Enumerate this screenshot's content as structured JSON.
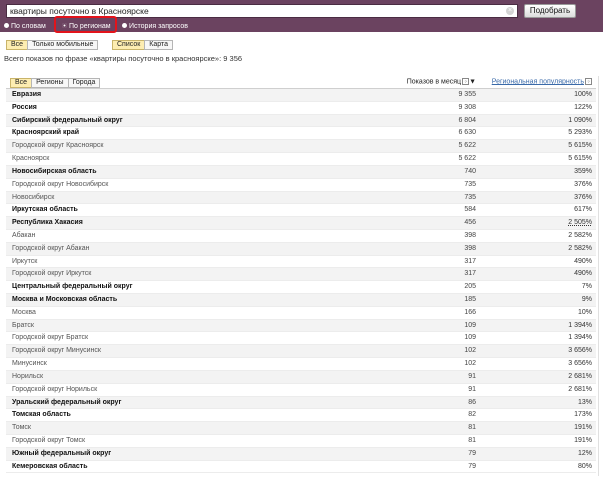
{
  "search": {
    "query": "квартиры посуточно в Красноярске",
    "submit_label": "Подобрать",
    "clear_icon": "×"
  },
  "modes": [
    {
      "label": "По словам",
      "active": false
    },
    {
      "label": "По регионам",
      "active": true
    },
    {
      "label": "История запросов",
      "active": false
    }
  ],
  "filter": {
    "all": "Все",
    "mobile": "Только мобильные"
  },
  "view": {
    "list": "Список",
    "map": "Карта"
  },
  "summary": "Всего показов по фразе «квартиры посуточно в красноярске»: 9 356",
  "table": {
    "tabs": [
      "Все",
      "Регионы",
      "Города"
    ],
    "col_count": "Показов в месяц",
    "sort_arrow": "▼",
    "col_pop": "Региональная популярность",
    "help_icon": "?",
    "rows": [
      {
        "name": "Евразия",
        "count": "9 355",
        "pop": "100%",
        "bold": true
      },
      {
        "name": "Россия",
        "count": "9 308",
        "pop": "122%",
        "bold": true
      },
      {
        "name": "Сибирский федеральный округ",
        "count": "6 804",
        "pop": "1 090%",
        "bold": true
      },
      {
        "name": "Красноярский край",
        "count": "6 630",
        "pop": "5 293%",
        "bold": true
      },
      {
        "name": "Городской округ Красноярск",
        "count": "5 622",
        "pop": "5 615%",
        "bold": false
      },
      {
        "name": "Красноярск",
        "count": "5 622",
        "pop": "5 615%",
        "bold": false
      },
      {
        "name": "Новосибирская область",
        "count": "740",
        "pop": "359%",
        "bold": true
      },
      {
        "name": "Городской округ Новосибирск",
        "count": "735",
        "pop": "376%",
        "bold": false
      },
      {
        "name": "Новосибирск",
        "count": "735",
        "pop": "376%",
        "bold": false
      },
      {
        "name": "Иркутская область",
        "count": "584",
        "pop": "617%",
        "bold": true
      },
      {
        "name": "Республика Хакасия",
        "count": "456",
        "pop": "2 505%",
        "bold": true,
        "dotted": true
      },
      {
        "name": "Абакан",
        "count": "398",
        "pop": "2 582%",
        "bold": false
      },
      {
        "name": "Городской округ Абакан",
        "count": "398",
        "pop": "2 582%",
        "bold": false
      },
      {
        "name": "Иркутск",
        "count": "317",
        "pop": "490%",
        "bold": false
      },
      {
        "name": "Городской округ Иркутск",
        "count": "317",
        "pop": "490%",
        "bold": false
      },
      {
        "name": "Центральный федеральный округ",
        "count": "205",
        "pop": "7%",
        "bold": true
      },
      {
        "name": "Москва и Московская область",
        "count": "185",
        "pop": "9%",
        "bold": true
      },
      {
        "name": "Москва",
        "count": "166",
        "pop": "10%",
        "bold": false
      },
      {
        "name": "Братск",
        "count": "109",
        "pop": "1 394%",
        "bold": false
      },
      {
        "name": "Городской округ Братск",
        "count": "109",
        "pop": "1 394%",
        "bold": false
      },
      {
        "name": "Городской округ Минусинск",
        "count": "102",
        "pop": "3 656%",
        "bold": false
      },
      {
        "name": "Минусинск",
        "count": "102",
        "pop": "3 656%",
        "bold": false
      },
      {
        "name": "Норильск",
        "count": "91",
        "pop": "2 681%",
        "bold": false
      },
      {
        "name": "Городской округ Норильск",
        "count": "91",
        "pop": "2 681%",
        "bold": false
      },
      {
        "name": "Уральский федеральный округ",
        "count": "86",
        "pop": "13%",
        "bold": true
      },
      {
        "name": "Томская область",
        "count": "82",
        "pop": "173%",
        "bold": true
      },
      {
        "name": "Томск",
        "count": "81",
        "pop": "191%",
        "bold": false
      },
      {
        "name": "Городской округ Томск",
        "count": "81",
        "pop": "191%",
        "bold": false
      },
      {
        "name": "Южный федеральный округ",
        "count": "79",
        "pop": "12%",
        "bold": true
      },
      {
        "name": "Кемеровская область",
        "count": "79",
        "pop": "80%",
        "bold": true
      }
    ]
  },
  "colors": {
    "header_bg": "#6b4360",
    "highlight": "#e3131b",
    "selected_tab": "#fdedb1",
    "link": "#3a6aa9"
  }
}
